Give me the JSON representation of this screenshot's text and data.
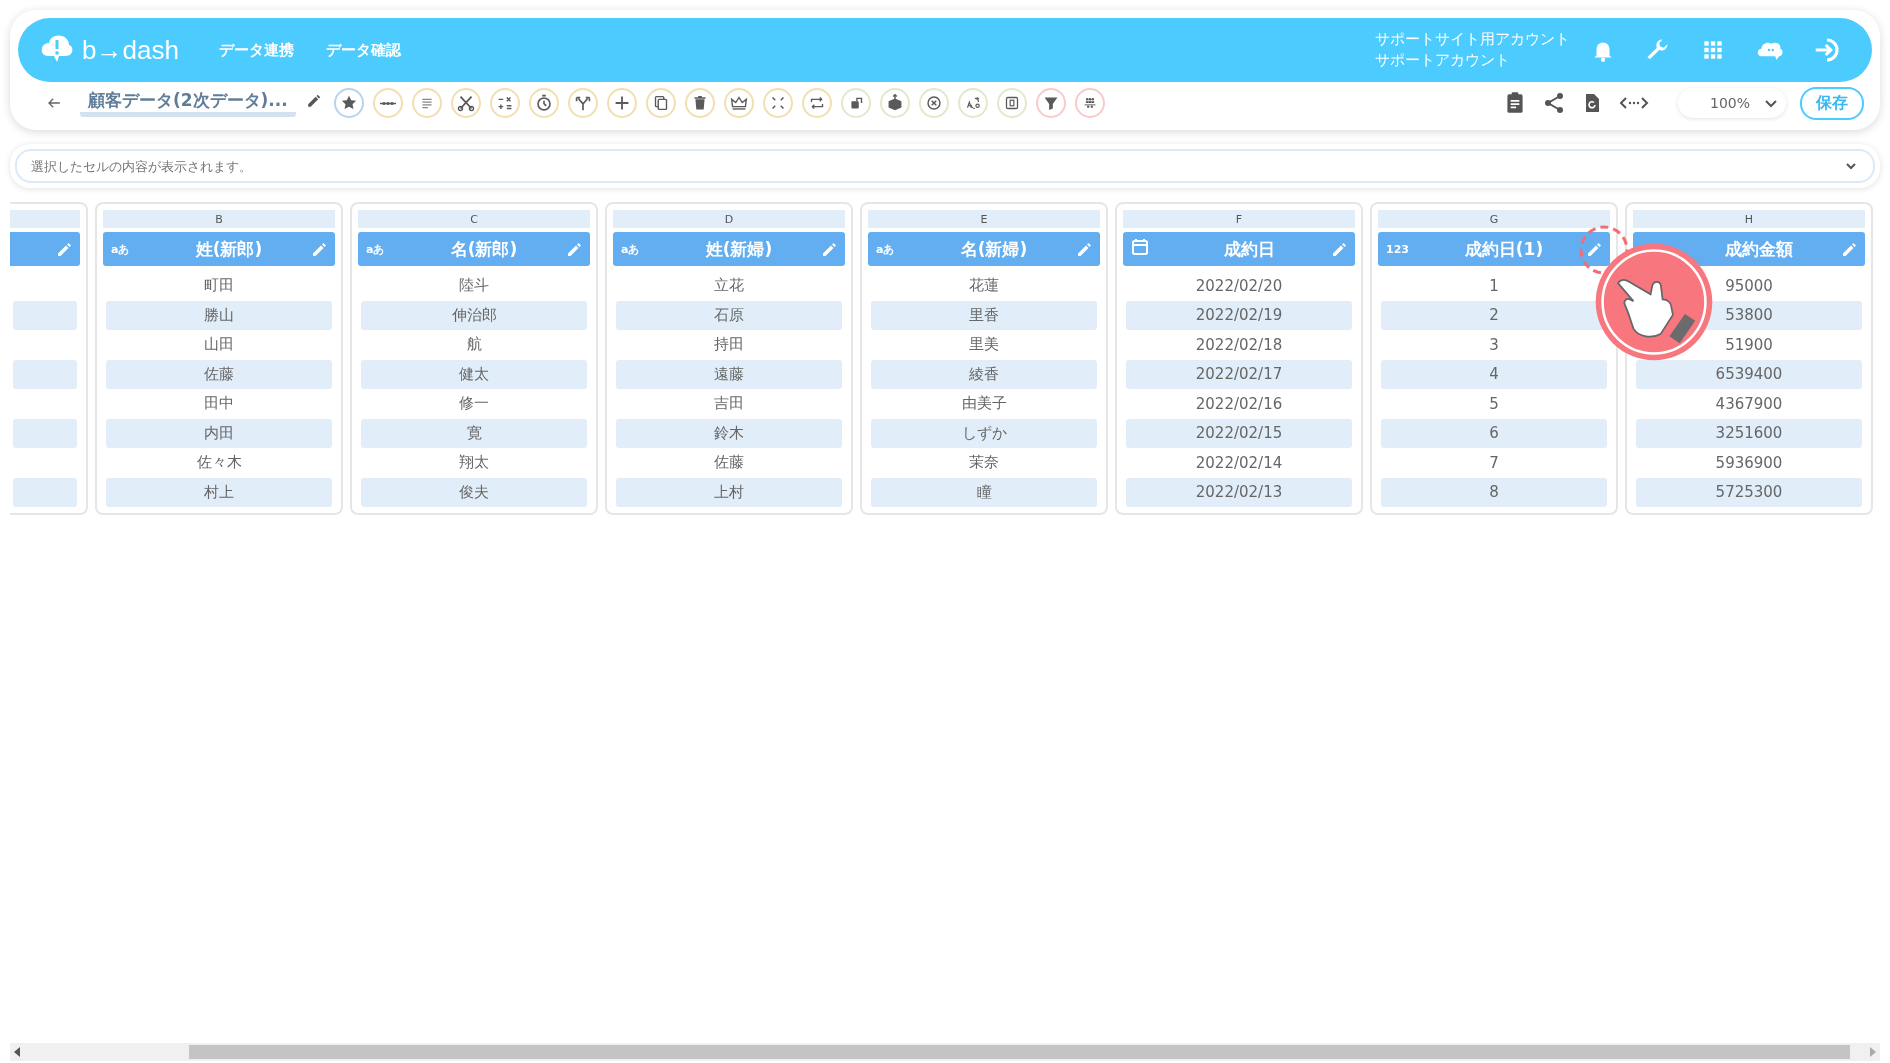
{
  "header": {
    "logo": "b→dash",
    "nav": [
      "データ連携",
      "データ確認"
    ],
    "account": [
      "サポートサイト用アカウント",
      "サポートアカウント"
    ]
  },
  "toolbar": {
    "title": "顧客データ(2次データ)...",
    "zoom": "100%",
    "save": "保存"
  },
  "cell_bar": {
    "placeholder": "選択したセルの内容が表示されます。"
  },
  "columns": [
    {
      "kind": "cut",
      "pointed": false,
      "cells": [
        "",
        "",
        "",
        "",
        "",
        "",
        "",
        ""
      ]
    },
    {
      "letter": "B",
      "kind": "text",
      "type_label": "aあ",
      "name": "姓(新郎)",
      "pointed": false,
      "cells": [
        "町田",
        "勝山",
        "山田",
        "佐藤",
        "田中",
        "内田",
        "佐々木",
        "村上"
      ]
    },
    {
      "letter": "C",
      "kind": "text",
      "type_label": "aあ",
      "name": "名(新郎)",
      "pointed": false,
      "cells": [
        "陸斗",
        "伸治郎",
        "航",
        "健太",
        "修一",
        "寛",
        "翔太",
        "俊夫"
      ]
    },
    {
      "letter": "D",
      "kind": "text",
      "type_label": "aあ",
      "name": "姓(新婦)",
      "pointed": false,
      "cells": [
        "立花",
        "石原",
        "持田",
        "遠藤",
        "吉田",
        "鈴木",
        "佐藤",
        "上村"
      ]
    },
    {
      "letter": "E",
      "kind": "text",
      "type_label": "aあ",
      "name": "名(新婦)",
      "pointed": false,
      "cells": [
        "花蓮",
        "里香",
        "里美",
        "綾香",
        "由美子",
        "しずか",
        "茉奈",
        "瞳"
      ]
    },
    {
      "letter": "F",
      "kind": "date",
      "name": "成約日",
      "pointed": false,
      "cells": [
        "2022/02/20",
        "2022/02/19",
        "2022/02/18",
        "2022/02/17",
        "2022/02/16",
        "2022/02/15",
        "2022/02/14",
        "2022/02/13"
      ]
    },
    {
      "letter": "G",
      "kind": "number",
      "type_label": "123",
      "name": "成約日(1)",
      "pointed": true,
      "cells": [
        "1",
        "2",
        "3",
        "4",
        "5",
        "6",
        "7",
        "8"
      ]
    },
    {
      "letter": "H",
      "kind": "hidden",
      "name": "成約金額",
      "pointed": false,
      "cells": [
        "95000",
        "53800",
        "51900",
        "6539400",
        "4367900",
        "3251600",
        "5936900",
        "5725300"
      ]
    }
  ]
}
